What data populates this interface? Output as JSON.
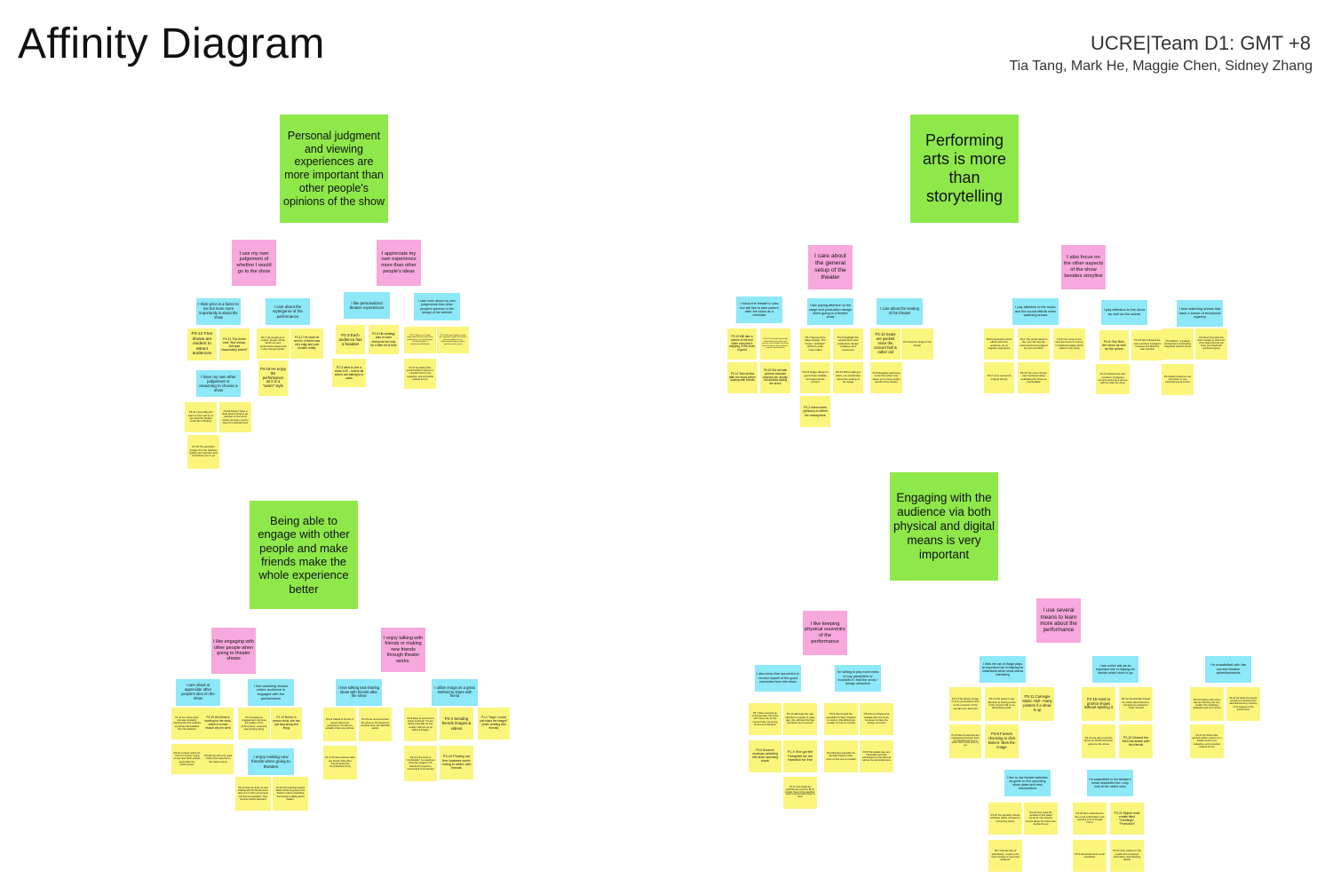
{
  "header": {
    "title": "Affinity Diagram",
    "team": "UCRE|Team D1: GMT +8",
    "members": "Tia Tang, Mark He, Maggie Chen, Sidney Zhang"
  },
  "colors": {
    "theme": "#8ee84a",
    "insight": "#f7a8dc",
    "finding": "#8de8f7",
    "quote": "#fbf57c"
  },
  "themes": [
    "Personal judgment and viewing experiences are more important than other people's opinions of the show",
    "Performing arts is more than storytelling",
    "Being able to engage with other people and make friends make the whole experience better",
    "Engaging with the audience via both physical and digital means is very important"
  ],
  "insights": [
    "I use my own judgement of whether I would go to the show",
    "I appreciate my own experience more than other people's ideas",
    "I care about the general setup of the theater",
    "I also focus on the other aspects of the show besides storyline",
    "I like engaging with other people when going to theater shows",
    "I enjoy talking with friends or making new friends through theater works.",
    "I like keeping physical souvenirs of the performance",
    "I use several means to learn more about the performance"
  ],
  "findings": [
    "I think price is a factor to me but more more importantly is about the show",
    "I care about the style/genre of the performance",
    "I have my own other judgement or reasoning to choose a show",
    "I like personalized theater experiences",
    "I care more about my own judgements than other people's opinions or the design of the website",
    "I follow the theater's rules but still like to take picture after the show as a reminder",
    "I like paying attention to the stage and production design when going to a theater show",
    "I care about the seating of the theater",
    "I pay attention to the music and the sound effects when watching shows",
    "I pay attention to the show as well as the actors",
    "I love watching shows that have a sense of emotional urgency",
    "I care about or appreciate other people's idea on the show",
    "I like watching shows where audience is engaged with the performance",
    "I enjoy making new friends when going to theaters",
    "I love talking and sharing ideas with friends after the show",
    "I utilize image as a great method to share with friend",
    "I also keep free souvenirs to remind myself of the good memories from the show",
    "I'm willing to pay more extra to buy pamphlets or booklets if I find the show / design attractive",
    "I think the use of image plays an important role in helping me understand which show seems interesting",
    "I see online ads as an important role in helping me decide which show to go",
    "I'm unsatisfied with the current theater advertisements",
    "I like to use theater websites as guide to find upcoming show dates and read introductions",
    "I'm subscribed to the theater's email newsletter but I only look at the useful ones"
  ],
  "quotes": [
    "P3-12 Free shows are evident to attract audiences",
    "P4-11 The ticket was \"Not cheap, but was reasonably priced\"",
    "P2-7 He usually go to modern theater works, which are less performance based and more concept centric",
    "P2-11 The show he went to in Berlin was very edgy and post modern reality",
    "P4-19 He enjoy the performance as it is a \"warm\" style",
    "P2-3 Each audience has a headset",
    "P2-5 His strategy was to have everyone but only for a little bit of time",
    "P2-3 went to see a show in B... where all actors are talking to a radio",
    "P4-21 I generally just want to work and try to see what the theater looks like in Beijing",
    "P4-23 Doesn't have a clear idea of what to go, decided on the show mostly because need to have fun entertainment",
    "P2-15 The pamphlet (image from the website) guides your attention and sometimes you to go",
    "P4-17 When he is really interested into the content of a performance, he would ignore the bad design of advertisement/website",
    "P4-16 He don't bother to read the comments under the drama because didn't want to influenced by other people's opinions on the show",
    "P2-17 He thinks other general public's opinion on a theater work is very subjective, and somewhat useless for him",
    "P3-19 Will take a picture of the end when everyone's clapping, if the show is good",
    "P4-14 The photos generally taken before the show and post on social media to record that the theater he would also visit the small theatres",
    "P3-14 Took photos after the show before sharing with friends",
    "P3-15 Did not take pictures because pictures are usually not allowed during the show",
    "P3-7 Enjoyed the stage design. The house \"unfolded\" which is quite memorable",
    "P3-3 Highlight the experiences and production design (makeup and costumes)",
    "P3-15 Stage design is good show visibility and appropriate content",
    "P3-23 When taking a photo, he would care about the setting of the stage",
    "P4-2 warm tones (yellows) to reflect the atmosphere",
    "P3-10 Seats are packed since the concert hall is rather old",
    "P1-5 Acoustic design of the theater",
    "P1-8 Negative that being in the front show may cause you to lose certain visuals of the theater",
    "P3-8 Impressive sound effects and nice audience, as no negative experience",
    "P4-7 The performance is like \"you can see the instruments being played by cool members\"",
    "P4-9 The music is the best part since it's wrong in traditional dudes which makes it very lively",
    "P1-2 Love everyone singing strong",
    "P3-16 \"No more chords\" was mentioned when evaluating the show as \"comfortable\"",
    "P4-6 She likes the show as well as the actors",
    "P3-19 She followed the cast members Instagram because she likes the cast member",
    "P1-6 Followed the cast member's Instagram account and took a picture with her after the show",
    "P3-3 Bolero - a gradual development of increasing magnitude until the climax",
    "P4-8 Every time when the artist manages to show more of the stage show she can better see himself with emotional urgency",
    "P2-6 Each audience can only listen to one actor/actress at a time",
    "P1-11 For online show, she was constantly checking the chat windows to just see the feedback from the audience",
    "P2-19 His friend is working for the show, which is a main reason why he went",
    "P3-13 Audience engagement improves the quality of the performance, everyone was singing along",
    "P1-12 But for in person show, she can just sing along and enjoy",
    "P4-16 Looked online for \"word of mouse\" trying to see how other people appreciate the performance",
    "P2-18 He will only read critics (the experts in the field) review",
    "P3-11 Likes his show, he was chatting with his friends and a lady next to them just jumped into their conversation. They became friends afterward",
    "P1-16 One important aspect Mister thinks by going to the theater is about expanding \"Everybody is talking about theater\"",
    "P4-13 Talked to friends in person about his experience, but did not actually share any picture",
    "P2-15 He recommended the show to his friends by sending them the WeChat article",
    "P1-17 Posted pictures after the shows Told other friends about the story/brainstorming",
    "P4-4 Sending friends images & videos",
    "P1-1 \"Says! I would just share the images\" (when chatting with friends)",
    "P4-8 Ways to recommend shows to friends: \"It's are faking especially we say, usually I will just put up videos & images\"",
    "P4-10 If the show is \"comfortable\", he would just show the images to his friends (if he wants to recommend to his friends)",
    "P3-15 Posting out fine features worth noting to share with friends",
    "P3-7 Also received an envelope after the show with more info on the concert hall, upcoming shows and donation",
    "P1-10 Although she saw Hamilton a couple of years ago, she still kept the free pamphlet as a souvenir",
    "P3-6 Souvenir envelope containing info about upcoming shows",
    "P1-9 She got the Pamphlet for the Hamilton for free",
    "P4-12 I just bought the pamphlet as a souvenir. But in London I have to buy pamphlet, I want to spend extra money on these",
    "P3-5 She bought the pamphlet for Mary Poppins in London; Pamphlets are usually not free in London",
    "P3-9 He purchased the booklet after the show because he likes the design and color",
    "P3-4 Bought a pamphlet for the Mary Poppins show, since no free one is provided",
    "P3-8 The booklet was very information and has introductions of the show as well as the actors/actresses",
    "P3-4 The flower image is very provocative and is the emotion of the symphony's last part",
    "P3-13 Not going to pay attention to boring picture of the concert hall on an advertising poster",
    "P3-11 Carnegie Music Hall - many posters if a show is up",
    "P1-16 Saw the advertisement image/poster/promotion when the advertisement is on a poster which would catch my eye",
    "P3-8 Factors choosing to click Bolero: likes the image",
    "P4-15 Hard to promot shows without spoiling it",
    "P4-13 Intentionally looked for online advertisement, because he wanted to \"treat\" himself",
    "P2-14 He also read the show on WeChat before going to the show",
    "P2-20 Shared the WeChat article with his friends",
    "P3-10 Problem with online ads are that they are very similar. The marketing strategies was very narrow",
    "P4-16 He wants the theater company to diversify their advertisements by showing more snippets of the performance",
    "P2-17 He thinks other general public's opinion on a theater work is very subjective, and somewhat useless for him",
    "P3-25 He regularly checks websites (twice a week) for upcoming shows",
    "P4-14 Only used the website to find dates because she already knows about the show was decided to go",
    "P3-7 Narrow way of advertising - needs to be more creative to get more audience",
    "P3-23 He's subscribed to the email subscription and receives a lot of emails from it",
    "P3-21 Skiped most emails titled \"Greetings\", \"Promotion\"",
    "P3-6 Advertisements email newsletter",
    "P3-22 Only clicked on the emails with composer information and ticketing details"
  ]
}
